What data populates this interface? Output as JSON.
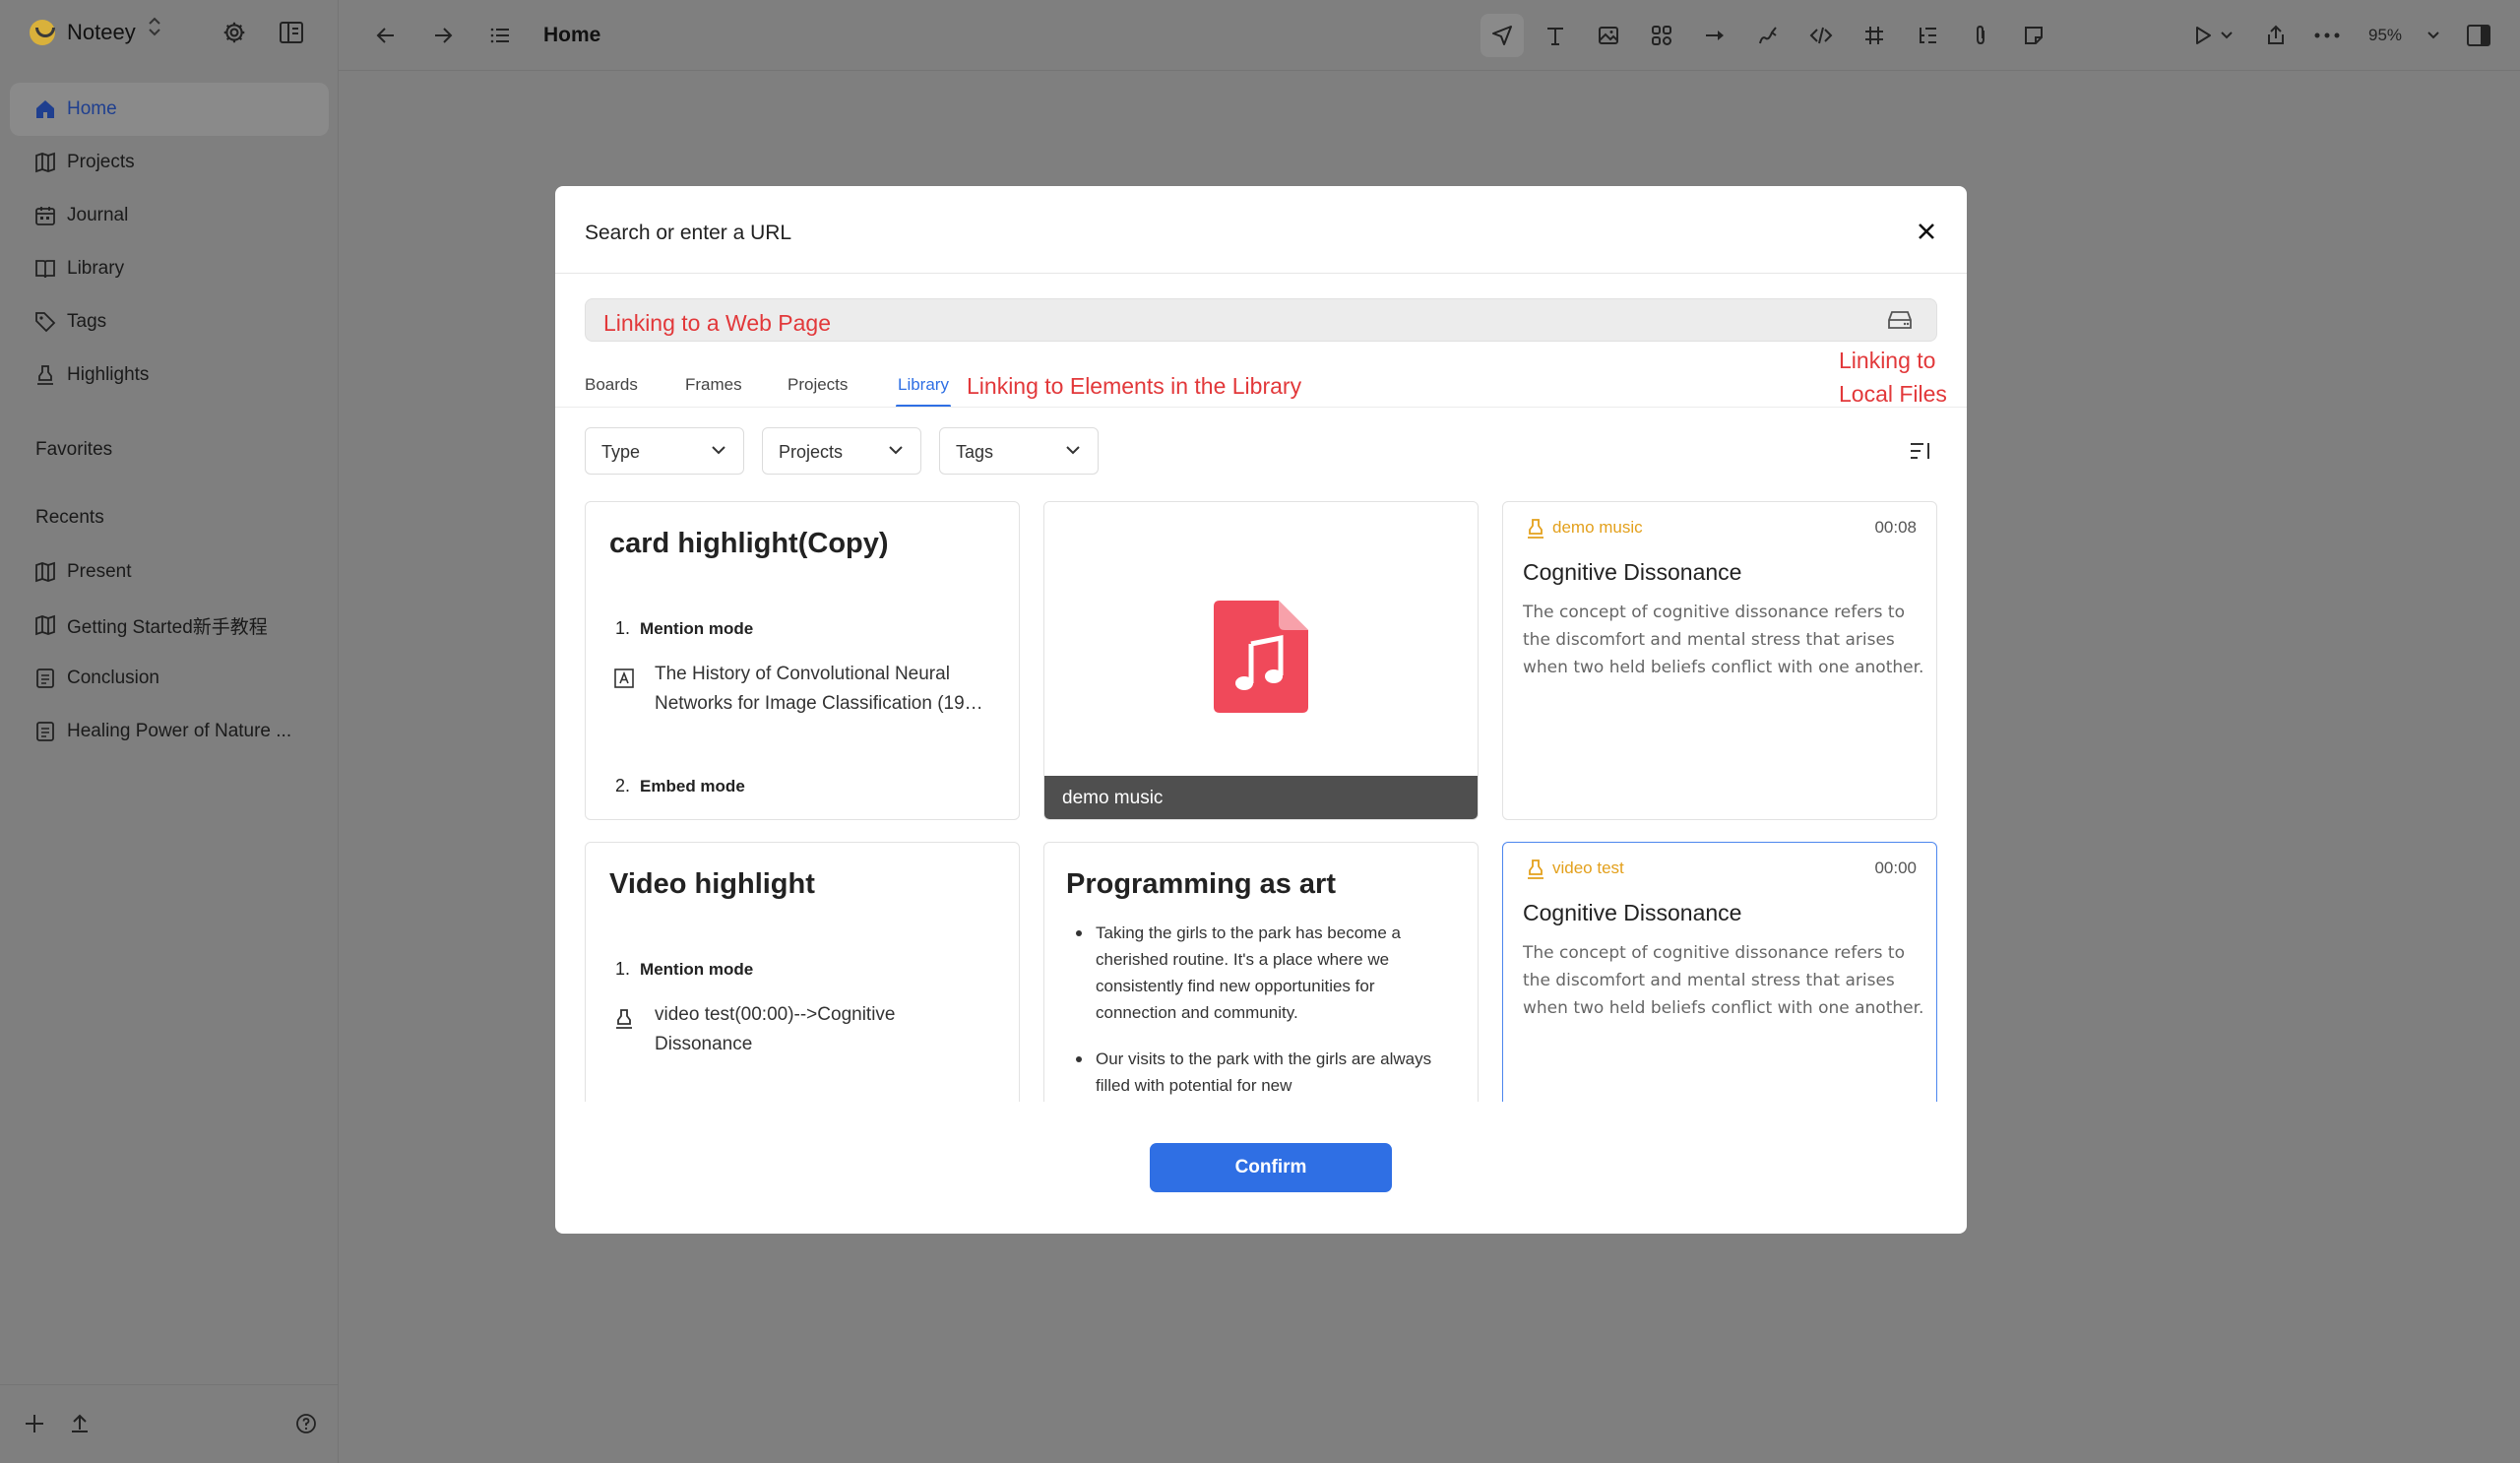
{
  "app": {
    "name": "Noteey"
  },
  "sidebar": {
    "nav": [
      {
        "label": "Home"
      },
      {
        "label": "Projects"
      },
      {
        "label": "Journal"
      },
      {
        "label": "Library"
      },
      {
        "label": "Tags"
      },
      {
        "label": "Highlights"
      }
    ],
    "favorites_label": "Favorites",
    "recents_label": "Recents",
    "recents": [
      {
        "label": "Present"
      },
      {
        "label": "Getting Started新手教程"
      },
      {
        "label": "Conclusion"
      },
      {
        "label": "Healing Power of Nature ..."
      }
    ]
  },
  "toolbar": {
    "title": "Home",
    "zoom": "95%"
  },
  "modal": {
    "title": "Search or enter a URL",
    "url_placeholder": "Linking to a Web Page",
    "note_library": "Linking to Elements in the Library",
    "note_local_line1": "Linking to",
    "note_local_line2": "Local Files",
    "tabs": [
      {
        "label": "Boards"
      },
      {
        "label": "Frames"
      },
      {
        "label": "Projects"
      },
      {
        "label": "Library"
      }
    ],
    "filters": [
      {
        "label": "Type"
      },
      {
        "label": "Projects"
      },
      {
        "label": "Tags"
      }
    ],
    "confirm_label": "Confirm"
  },
  "cards": {
    "card1": {
      "title": "card highlight(Copy)",
      "item1_num": "1.",
      "item1_label": "Mention mode",
      "ref_text": "The History of Convolutional Neural Networks for Image Classification (19…",
      "item2_num": "2.",
      "item2_label": "Embed mode"
    },
    "card2": {
      "caption": "demo music"
    },
    "card3": {
      "source": "demo music",
      "time": "00:08",
      "title": "Cognitive Dissonance",
      "text": "The concept of cognitive dissonance refers to the discomfort and mental stress that arises when two held beliefs conflict with one another."
    },
    "card4": {
      "title": "Video highlight",
      "item1_num": "1.",
      "item1_label": "Mention mode",
      "ref_text": "video test(00:00)-->Cognitive Dissonance"
    },
    "card5": {
      "title": "Programming as art",
      "bullet1": "Taking the girls to the park has become a cherished routine. It's a place where we consistently find new opportunities for connection and community.",
      "bullet2": "Our visits to the park with the girls are always filled with potential for new"
    },
    "card6": {
      "source": "video test",
      "time": "00:00",
      "title": "Cognitive Dissonance",
      "text": "The concept of cognitive dissonance refers to the discomfort and mental stress that arises when two held beliefs conflict with one another."
    }
  },
  "colors": {
    "accent": "#2f6fe4",
    "annotation": "#e2383a",
    "highlight_source": "#e3a01c",
    "music_icon": "#f0495a",
    "overlay": "#7f7f7f"
  },
  "icons": {
    "sidebar": [
      "home-icon",
      "map-icon",
      "calendar-icon",
      "book-icon",
      "tag-icon",
      "highlighter-icon"
    ],
    "toolbar": [
      "back-arrow-icon",
      "forward-arrow-icon",
      "list-icon",
      "pointer-icon",
      "text-icon",
      "image-icon",
      "shapes-icon",
      "arrow-icon",
      "pen-icon",
      "code-icon",
      "frame-icon",
      "outline-icon",
      "attachment-icon",
      "sticky-note-icon",
      "play-icon",
      "share-icon",
      "more-icon",
      "panel-icon"
    ]
  }
}
